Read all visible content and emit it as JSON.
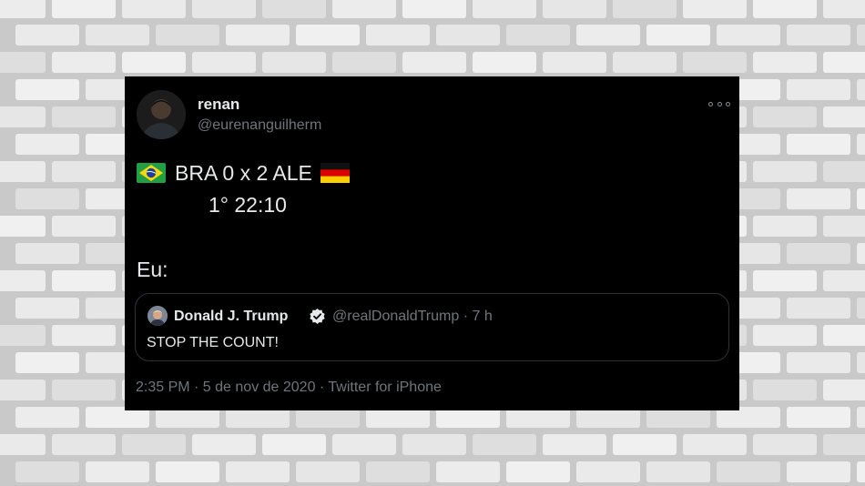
{
  "colors": {
    "wall_background": "#c9c9c9",
    "brick": "#ececec",
    "tweet_background": "#000000",
    "primary_text": "#e7e9ea",
    "secondary_text": "#71767b",
    "verified_badge": "#e7e9ea"
  },
  "tweet": {
    "author": {
      "display_name": "renan",
      "handle": "@eurenanguilherm",
      "avatar_icon": "user-avatar"
    },
    "menu_icon": "more-options-icon",
    "score_line": {
      "left_flag_icon": "brazil-flag-icon",
      "text": "BRA 0 x 2 ALE",
      "right_flag_icon": "germany-flag-icon"
    },
    "time_line": "1° 22:10",
    "reaction_line": "Eu:",
    "quoted_tweet": {
      "display_name": "Donald J. Trump",
      "verified_icon": "verified-badge-icon",
      "meta": "@realDonaldTrump · 7 h",
      "text": "STOP THE COUNT!"
    },
    "footer": "2:35 PM · 5 de nov de 2020 · Twitter for iPhone"
  }
}
